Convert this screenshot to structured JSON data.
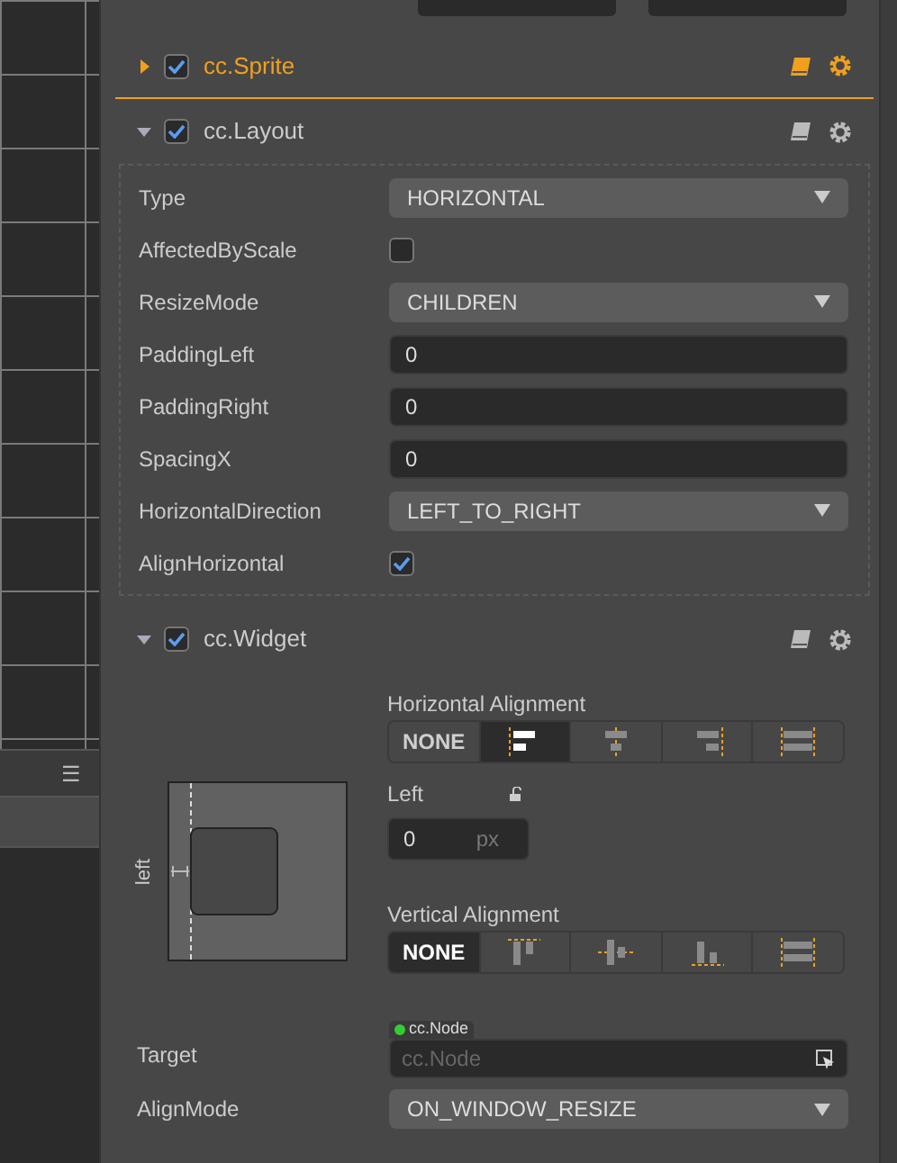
{
  "components": [
    {
      "name": "cc.Sprite",
      "expanded": false,
      "enabled": true,
      "highlighted": true
    },
    {
      "name": "cc.Layout",
      "expanded": true,
      "enabled": true,
      "highlighted": false
    },
    {
      "name": "cc.Widget",
      "expanded": true,
      "enabled": true,
      "highlighted": false
    }
  ],
  "layout_properties": [
    {
      "kind": "select",
      "label": "Type",
      "value": "HORIZONTAL"
    },
    {
      "kind": "checkbox",
      "label": "AffectedByScale",
      "checked": false
    },
    {
      "kind": "select",
      "label": "ResizeMode",
      "value": "CHILDREN"
    },
    {
      "kind": "number",
      "label": "PaddingLeft",
      "value": "0"
    },
    {
      "kind": "number",
      "label": "PaddingRight",
      "value": "0"
    },
    {
      "kind": "number",
      "label": "SpacingX",
      "value": "0"
    },
    {
      "kind": "select",
      "label": "HorizontalDirection",
      "value": "LEFT_TO_RIGHT"
    },
    {
      "kind": "checkbox",
      "label": "AlignHorizontal",
      "checked": true
    }
  ],
  "widget": {
    "diagram_label": "left",
    "horizontal_alignment": {
      "title": "Horizontal Alignment",
      "options": [
        {
          "kind": "none",
          "label": "NONE",
          "selected": false
        },
        {
          "kind": "left",
          "selected": true
        },
        {
          "kind": "center",
          "selected": false
        },
        {
          "kind": "right",
          "selected": false
        },
        {
          "kind": "stretch",
          "selected": false
        }
      ]
    },
    "left": {
      "label": "Left",
      "value": "0",
      "unit": "px"
    },
    "vertical_alignment": {
      "title": "Vertical Alignment",
      "options": [
        {
          "kind": "none",
          "label": "NONE",
          "selected": true
        },
        {
          "kind": "top",
          "selected": false
        },
        {
          "kind": "middle",
          "selected": false
        },
        {
          "kind": "bottom",
          "selected": false
        },
        {
          "kind": "stretch",
          "selected": false
        }
      ]
    },
    "target": {
      "label": "Target",
      "type_tag": "cc.Node",
      "placeholder": "cc.Node"
    },
    "align_mode": {
      "label": "AlignMode",
      "value": "ON_WINDOW_RESIZE"
    }
  },
  "hierarchy_panel": {
    "menu_icon": "☰"
  }
}
